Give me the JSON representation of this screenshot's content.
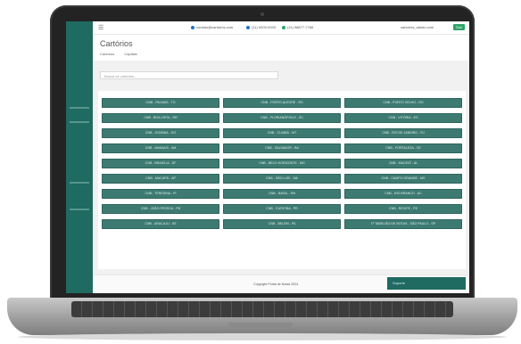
{
  "topbar": {
    "email": "contato@cartorios.com",
    "phone1": "(11) 0000-0000",
    "phone2": "(11) 98877-7766",
    "user": "cartorios_admin.com",
    "exit_label": "Sair"
  },
  "page": {
    "title": "Cartórios",
    "tabs": [
      "Cartórios",
      "Capitais"
    ]
  },
  "search": {
    "placeholder": "Busca os cartórios..."
  },
  "cartorios": [
    [
      "CNB - PALMAS - TO",
      "CNB - PORTO ALEGRE - RS",
      "CNB - PORTO VELHO - RO"
    ],
    [
      "CNB - BOA VISTA - RR",
      "CNB - FLORIANÓPOLIS - SC",
      "CNB - VITÓRIA - ES"
    ],
    [
      "CNB - GOIÂNIA - GO",
      "CNB - CUIABÁ - MT",
      "CNB - RIO DE JANEIRO - RJ"
    ],
    [
      "CNB - MANAUS - AM",
      "CNB - SALVADOR - BA",
      "CNB - FORTALEZA - CE"
    ],
    [
      "CNB - BRASÍLIA - DF",
      "CNB - BELO HORIZONTE - MG",
      "CNB - MACEIÓ - AL"
    ],
    [
      "CNB - MACAPÁ - AP",
      "CNB - SÃO LUÍS - MA",
      "CNB - CAMPO GRANDE - MS"
    ],
    [
      "CNB - TERESINA - PI",
      "CNB - NATAL - RN",
      "CNB - RIO BRANCO - AC"
    ],
    [
      "CNB - JOÃO PESSOA - PB",
      "CNB - CURITIBA - PR",
      "CNB - RECIFE - PE"
    ],
    [
      "CNB - ARACAJU - SE",
      "CNB - BELÉM - PA",
      "1º TABELIÃO DE NOTAS - SÃO PAULO - SP"
    ]
  ],
  "footer": {
    "copyright": "Copyright Portal de Notas 2024",
    "support_label": "Suporte"
  }
}
